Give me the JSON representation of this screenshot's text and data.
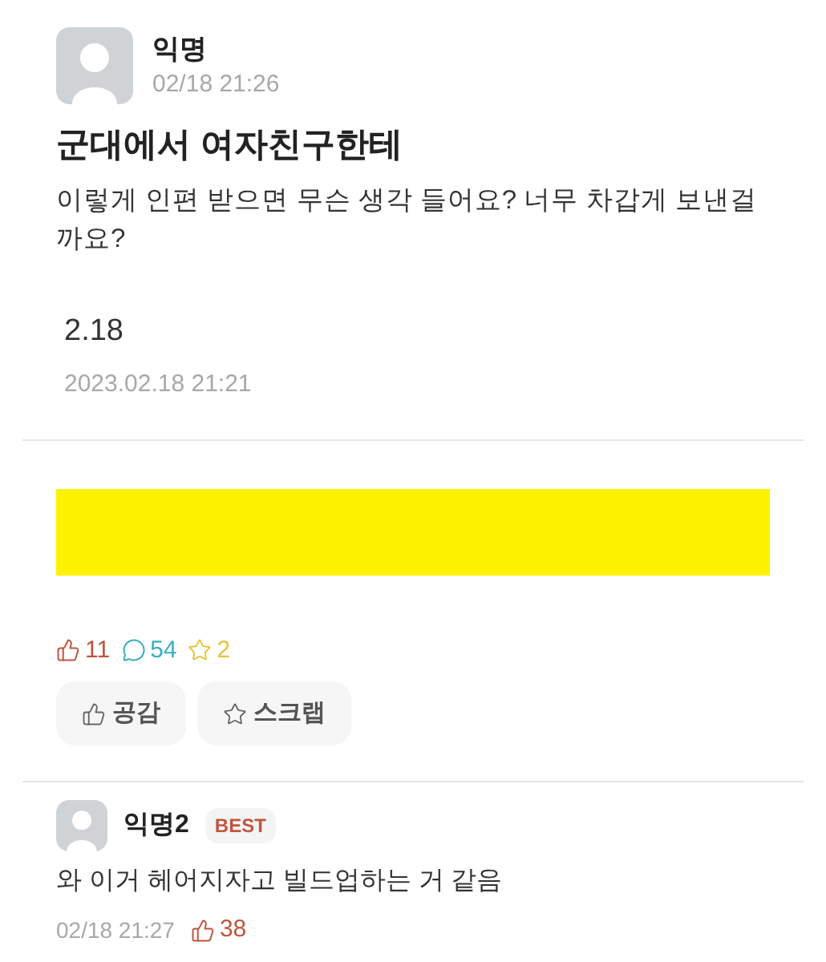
{
  "post": {
    "author": "익명",
    "time": "02/18 21:26",
    "title": "군대에서 여자친구한테",
    "body": "이렇게 인편 받으면 무슨 생각 들어요? 너무 차갑게 보낸걸 까요?",
    "note": "2.18",
    "note_date": "2023.02.18 21:21"
  },
  "stats": [
    {
      "kind": "like",
      "count": "11",
      "color": "#c0563e"
    },
    {
      "kind": "comment",
      "count": "54",
      "color": "#3aaec0"
    },
    {
      "kind": "scrap",
      "count": "2",
      "color": "#e5c53c"
    }
  ],
  "actions": [
    {
      "kind": "like",
      "label": "공감"
    },
    {
      "kind": "scrap",
      "label": "스크랩"
    }
  ],
  "comments": [
    {
      "author": "익명2",
      "badge": "BEST",
      "text": "와 이거 헤어지자고 빌드업하는 거 같음",
      "time": "02/18 21:27",
      "likes": "38"
    }
  ]
}
